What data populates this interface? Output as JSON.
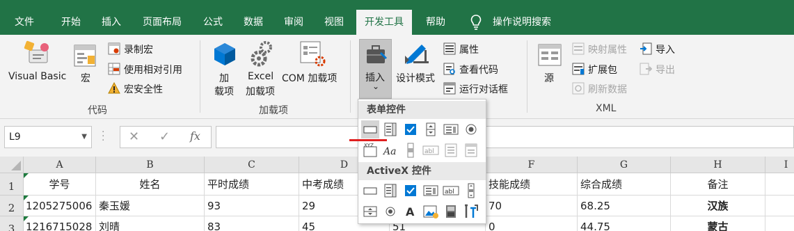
{
  "tabs": [
    "文件",
    "开始",
    "插入",
    "页面布局",
    "公式",
    "数据",
    "审阅",
    "视图",
    "开发工具",
    "帮助",
    "操作说明搜索"
  ],
  "active_tab": "开发工具",
  "ribbon": {
    "code": {
      "visual_basic": "Visual Basic",
      "macro": "宏",
      "record_macro": "录制宏",
      "relative_ref": "使用相对引用",
      "macro_security": "宏安全性",
      "group": "代码"
    },
    "addins": {
      "addin_l1": "加",
      "addin_l2": "载项",
      "excel_l1": "Excel",
      "excel_l2": "加载项",
      "com": "COM 加载项",
      "group": "加载项"
    },
    "controls": {
      "insert": "插入",
      "insert_arrow": "⌄",
      "design_mode": "设计模式",
      "properties": "属性",
      "view_code": "查看代码",
      "run_dialog": "运行对话框"
    },
    "xml": {
      "source": "源",
      "map_props": "映射属性",
      "expansion": "扩展包",
      "refresh": "刷新数据",
      "import": "导入",
      "export": "导出",
      "group": "XML"
    }
  },
  "namebox": "L9",
  "fx": "fx",
  "columns": [
    "A",
    "B",
    "C",
    "D",
    "E",
    "F",
    "G",
    "H",
    "I"
  ],
  "rows": [
    {
      "num": "1",
      "A": "学号",
      "B": "姓名",
      "C": "平时成绩",
      "D": "中考成绩",
      "E": "",
      "F": "技能成绩",
      "G": "综合成绩",
      "H": "备注"
    },
    {
      "num": "2",
      "A": "1205275006",
      "B": "秦玉媛",
      "C": "93",
      "D": "29",
      "E": "",
      "F": "70",
      "G": "68.25",
      "H": "汉族"
    },
    {
      "num": "3",
      "A": "1216715028",
      "B": "刘晴",
      "C": "83",
      "D": "45",
      "E": "51",
      "F": "0",
      "G": "44.75",
      "H": "蒙古"
    }
  ],
  "dropdown": {
    "form_controls": "表单控件",
    "activex_controls": "ActiveX 控件"
  },
  "colors": {
    "accent": "#217346",
    "ribbon_bg": "#f3f3f3",
    "highlight": "#e02020"
  }
}
